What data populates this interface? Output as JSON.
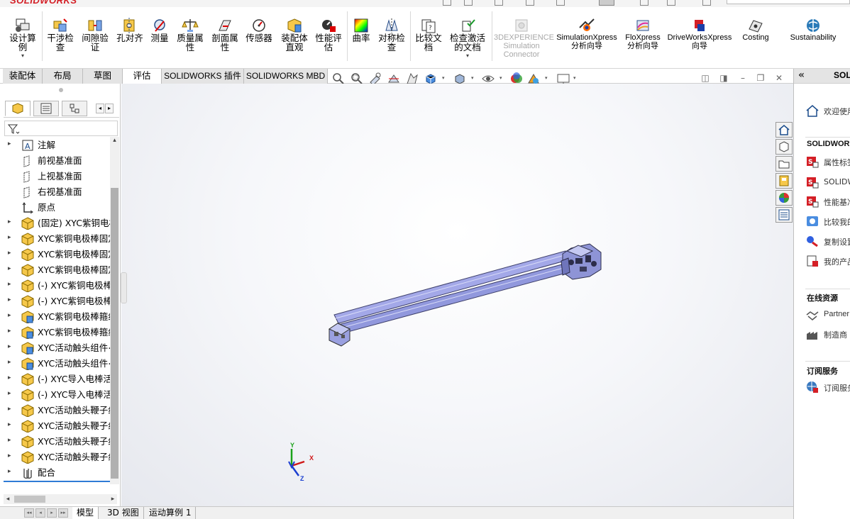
{
  "app": {
    "brand": "SOLIDWORKS"
  },
  "ribbon": {
    "items": [
      {
        "label": "设计算例",
        "icon": "design-study-icon"
      },
      {
        "label": "干涉检查",
        "icon": "interference-check-icon"
      },
      {
        "label": "间隙验证",
        "icon": "clearance-verification-icon"
      },
      {
        "label": "孔对齐",
        "icon": "hole-alignment-icon"
      },
      {
        "label": "测量",
        "icon": "measure-icon"
      },
      {
        "label": "质量属性",
        "icon": "mass-properties-icon"
      },
      {
        "label": "剖面属性",
        "icon": "section-properties-icon"
      },
      {
        "label": "传感器",
        "icon": "sensor-icon"
      },
      {
        "label": "装配体直观",
        "icon": "assembly-visualization-icon"
      },
      {
        "label": "性能评估",
        "icon": "performance-evaluation-icon"
      },
      {
        "label": "曲率",
        "icon": "curvature-icon"
      },
      {
        "label": "对称检查",
        "icon": "symmetry-check-icon"
      },
      {
        "label": "比较文档",
        "icon": "compare-documents-icon"
      },
      {
        "label": "检查激活的文档",
        "icon": "check-active-document-icon"
      },
      {
        "label": "3DEXPERIENCE Simulation Connector",
        "icon": "simulation-connector-icon",
        "disabled": true
      },
      {
        "label": "SimulationXpress 分析向导",
        "icon": "simulationxpress-icon"
      },
      {
        "label": "FloXpress 分析向导",
        "icon": "floxpress-icon"
      },
      {
        "label": "DriveWorksXpress 向导",
        "icon": "driveworksxpress-icon"
      },
      {
        "label": "Costing",
        "icon": "costing-icon"
      },
      {
        "label": "Sustainability",
        "icon": "sustainability-icon"
      }
    ]
  },
  "tabs": [
    "装配体",
    "布局",
    "草图",
    "评估",
    "SOLIDWORKS 插件",
    "SOLIDWORKS MBD"
  ],
  "active_tab": "评估",
  "feature_tree": {
    "items": [
      {
        "label": "注解",
        "icon": "annotations-icon",
        "expandable": true
      },
      {
        "label": "前视基准面",
        "icon": "plane-icon",
        "expandable": false
      },
      {
        "label": "上视基准面",
        "icon": "plane-icon",
        "expandable": false
      },
      {
        "label": "右视基准面",
        "icon": "plane-icon",
        "expandable": false
      },
      {
        "label": "原点",
        "icon": "origin-icon",
        "expandable": false
      },
      {
        "label": "(固定) XYC紫铜电极",
        "icon": "part-icon",
        "expandable": true
      },
      {
        "label": "XYC紫铜电极棒固定",
        "icon": "part-icon",
        "expandable": true
      },
      {
        "label": "XYC紫铜电极棒固定",
        "icon": "part-icon",
        "expandable": true
      },
      {
        "label": "XYC紫铜电极棒固定",
        "icon": "part-icon",
        "expandable": true
      },
      {
        "label": "(-) XYC紫铜电极棒",
        "icon": "part-icon",
        "expandable": true
      },
      {
        "label": "(-) XYC紫铜电极棒",
        "icon": "part-icon",
        "expandable": true
      },
      {
        "label": "XYC紫铜电极棒箍组",
        "icon": "subassembly-icon",
        "expandable": true
      },
      {
        "label": "XYC紫铜电极棒箍组",
        "icon": "subassembly-icon",
        "expandable": true
      },
      {
        "label": "XYC活动触头组件<",
        "icon": "subassembly-icon",
        "expandable": true
      },
      {
        "label": "XYC活动触头组件<",
        "icon": "subassembly-icon",
        "expandable": true
      },
      {
        "label": "(-) XYC导入电棒活",
        "icon": "part-icon",
        "expandable": true
      },
      {
        "label": "(-) XYC导入电棒活",
        "icon": "part-icon",
        "expandable": true
      },
      {
        "label": "XYC活动触头鞭子组",
        "icon": "part-icon",
        "expandable": true
      },
      {
        "label": "XYC活动触头鞭子组",
        "icon": "part-icon",
        "expandable": true
      },
      {
        "label": "XYC活动触头鞭子组",
        "icon": "part-icon",
        "expandable": true
      },
      {
        "label": "XYC活动触头鞭子组",
        "icon": "part-icon",
        "expandable": true
      },
      {
        "label": "配合",
        "icon": "mates-icon",
        "expandable": true
      }
    ]
  },
  "triad": {
    "x": "X",
    "y": "Y",
    "z": "Z"
  },
  "taskpane": {
    "title": "SOL",
    "welcome": "欢迎使用",
    "section1": "SOLIDWORKS",
    "tools": [
      "属性标签",
      "SOLIDW",
      "性能基准",
      "比较我的",
      "复制设置",
      "我的产品"
    ],
    "section2": "在线资源",
    "online": [
      "Partner",
      "制造商"
    ],
    "section3": "订阅服务",
    "subscription": [
      "订阅服务"
    ]
  },
  "bottom_tabs": [
    "模型",
    "3D 视图",
    "运动算例 1"
  ],
  "active_bottom_tab": "模型",
  "colors": {
    "brand_red": "#d41f26",
    "accent_blue": "#2f7bd6",
    "model_blue": "#9da3e6"
  }
}
